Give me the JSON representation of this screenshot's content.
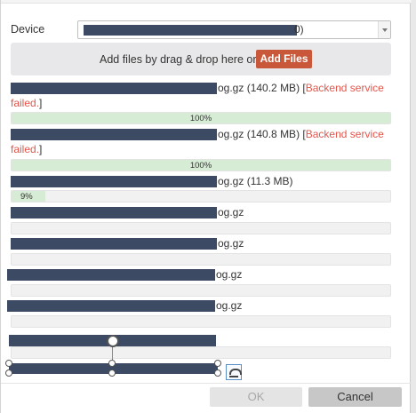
{
  "dialog": {
    "device_label": "Device",
    "device_value_suffix": "0)",
    "drop_text": "Add files by drag & drop here or",
    "add_files_label": "Add Files"
  },
  "files": [
    {
      "name_suffix": "og.gz",
      "size": "(140.2 MB)",
      "error_prefix": "[",
      "error": "Backend service",
      "error_cont": "failed.",
      "error_close": "]",
      "progress_label": "100%",
      "progress": 100
    },
    {
      "name_suffix": "og.gz",
      "size": "(140.8 MB)",
      "error_prefix": "[",
      "error": "Backend service",
      "error_cont": "failed.",
      "error_close": "]",
      "progress_label": "100%",
      "progress": 100
    },
    {
      "name_suffix": "og.gz",
      "size": "(11.3 MB)",
      "progress_label": "9%",
      "progress": 9
    },
    {
      "name_suffix": "og.gz",
      "progress": 0
    },
    {
      "name_suffix": "og.gz",
      "progress": 0
    },
    {
      "name_suffix": "og.gz",
      "progress": 0
    },
    {
      "name_suffix": "og.gz",
      "progress": 0
    },
    {
      "progress": 0
    }
  ],
  "footer": {
    "ok_label": "OK",
    "cancel_label": "Cancel"
  },
  "colors": {
    "accent": "#c9583a",
    "error": "#e2574c",
    "progress_fill": "#d7ecd5",
    "redaction": "#3c4a63"
  }
}
